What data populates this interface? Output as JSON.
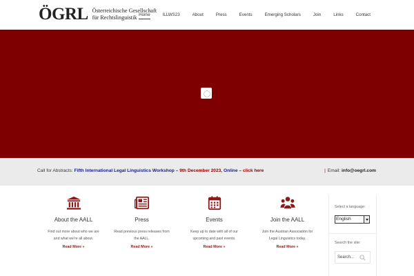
{
  "header": {
    "logo_mark": "ÖGRL",
    "logo_line1": "Österreichische Gesellschaft",
    "logo_line2": "für Rechtslinguistik",
    "nav": [
      {
        "label": "Home",
        "active": true
      },
      {
        "label": "ILLWS23"
      },
      {
        "label": "About"
      },
      {
        "label": "Press"
      },
      {
        "label": "Events"
      },
      {
        "label": "Emerging Scholars"
      },
      {
        "label": "Join"
      },
      {
        "label": "Links"
      },
      {
        "label": "Contact"
      }
    ]
  },
  "hero": {
    "background": "#7e0000"
  },
  "banner": {
    "prefix": "Call for Abstracts:",
    "workshop": "Fifth International Legal Linguistics Workshop –",
    "date": "9th December 2023,",
    "online": "Online",
    "dash": "–",
    "link": "click here",
    "email_label": "Email:",
    "email": "info@oegrl.com"
  },
  "features": [
    {
      "icon": "institution-icon",
      "title": "About the AALL",
      "desc1": "Find out more about who we are",
      "desc2": "and what we’re all about.",
      "more": "Read More »"
    },
    {
      "icon": "newspaper-icon",
      "title": "Press",
      "desc1": "Read previous press releases from",
      "desc2": "the AALL.",
      "more": "Read More »"
    },
    {
      "icon": "calendar-icon",
      "title": "Events",
      "desc1": "Keep up to date with all of our",
      "desc2": "upcoming and past events.",
      "more": "Read More »"
    },
    {
      "icon": "users-icon",
      "title": "Join the AALL",
      "desc1": "Join the Austrian Association for",
      "desc2": "Legal Linguistics today.",
      "more": "Read More »"
    }
  ],
  "sidebar": {
    "language_label": "Select a language:",
    "language_value": "English",
    "search_label": "Search the site:",
    "search_placeholder": "Search..."
  },
  "colors": {
    "accent": "#8b1a1a",
    "hero": "#7e0000",
    "banner_bg": "#ebebeb",
    "link_blue": "#1a237e"
  }
}
